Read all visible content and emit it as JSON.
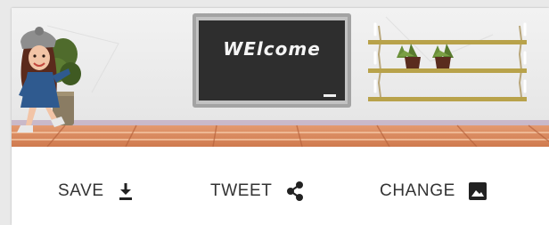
{
  "banner": {
    "board_text": "WElcome"
  },
  "toolbar": {
    "save_label": "SAVE",
    "save_icon": "download-icon",
    "tweet_label": "TWEET",
    "tweet_icon": "share-icon",
    "change_label": "CHANGE",
    "change_icon": "image-icon"
  },
  "colors": {
    "floor": "#d9845a",
    "chalkboard": "#2e2e2e",
    "board_frame": "#9a9a9a",
    "shelf": "#b8a24a",
    "text": "#333333"
  }
}
